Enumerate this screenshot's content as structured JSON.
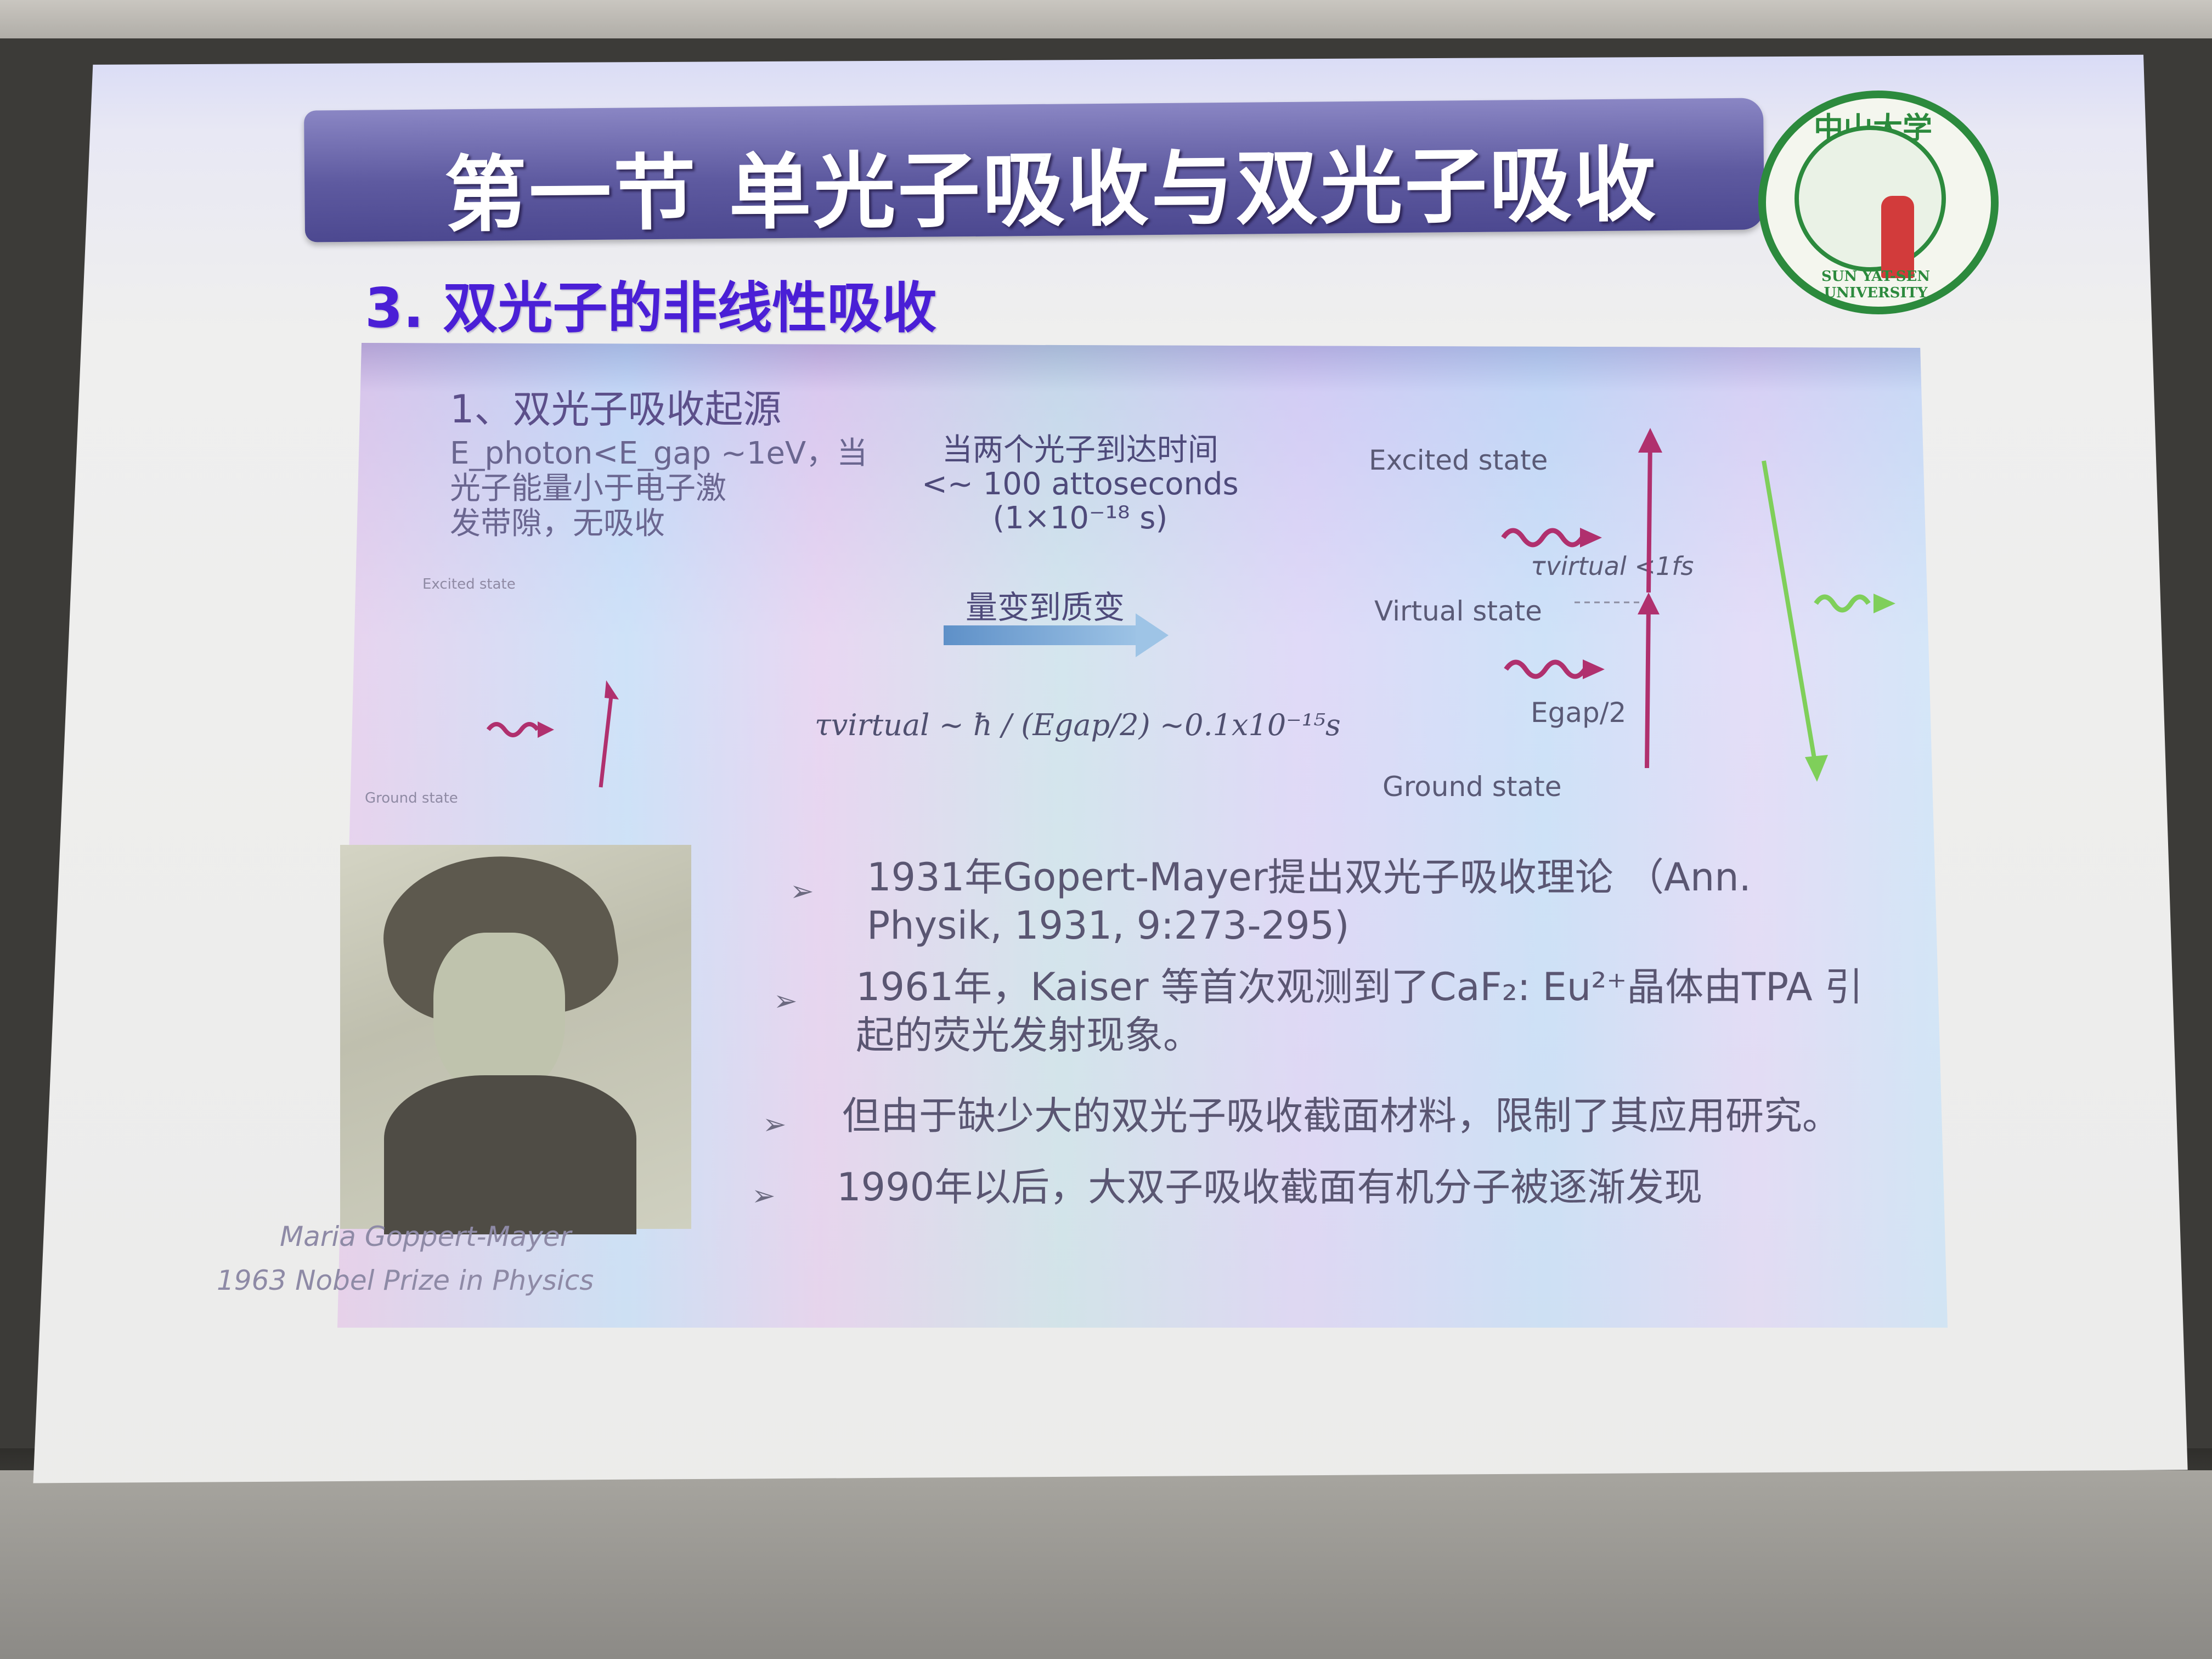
{
  "slide": {
    "title": "第一节  单光子吸收与双光子吸收",
    "subheading": "3. 双光子的非线性吸收",
    "logo": {
      "top_text": "中山大学",
      "ring_text": "SUN YAT-SEN UNIVERSITY"
    }
  },
  "inner_slide": {
    "heading": "1、双光子吸收起源",
    "left_note": "E_photon<E_gap ~1eV，当\n光子能量小于电子激\n发带隙，无吸收",
    "left_excited_label": "Excited state",
    "left_ground_label": "Ground state",
    "mid_note": "当两个光子到达时间\n<~ 100 attoseconds\n(1×10⁻¹⁸ s)",
    "change_label": "量变到质变",
    "formula": "τvirtual ~ ħ / (Egap/2) ~0.1x10⁻¹⁵s",
    "diagram": {
      "excited_state": "Excited state",
      "virtual_state": "Virtual state",
      "ground_state": "Ground state",
      "tau_label": "τvirtual <1fs",
      "egap_label": "Egap/2"
    },
    "bullets": [
      "1931年Gopert-Mayer提出双光子吸收理论 （Ann.\nPhysik, 1931, 9:273-295)",
      "1961年，Kaiser 等首次观测到了CaF₂: Eu²⁺晶体由TPA 引\n起的荧光发射现象。",
      "但由于缺少大的双光子吸收截面材料，限制了其应用研究。",
      "1990年以后，大双子吸收截面有机分子被逐渐发现"
    ],
    "bullet_marker": "➢",
    "photo_caption_line1": "Maria Goppert-Mayer",
    "photo_caption_line2": "1963 Nobel Prize in Physics"
  },
  "colors": {
    "title_bar": "#5e5aa0",
    "subheading": "#4a1fd6",
    "logo_green": "#2c8a3d",
    "arrow_magenta": "#b0306e",
    "arrow_green": "#7fcf5a"
  }
}
